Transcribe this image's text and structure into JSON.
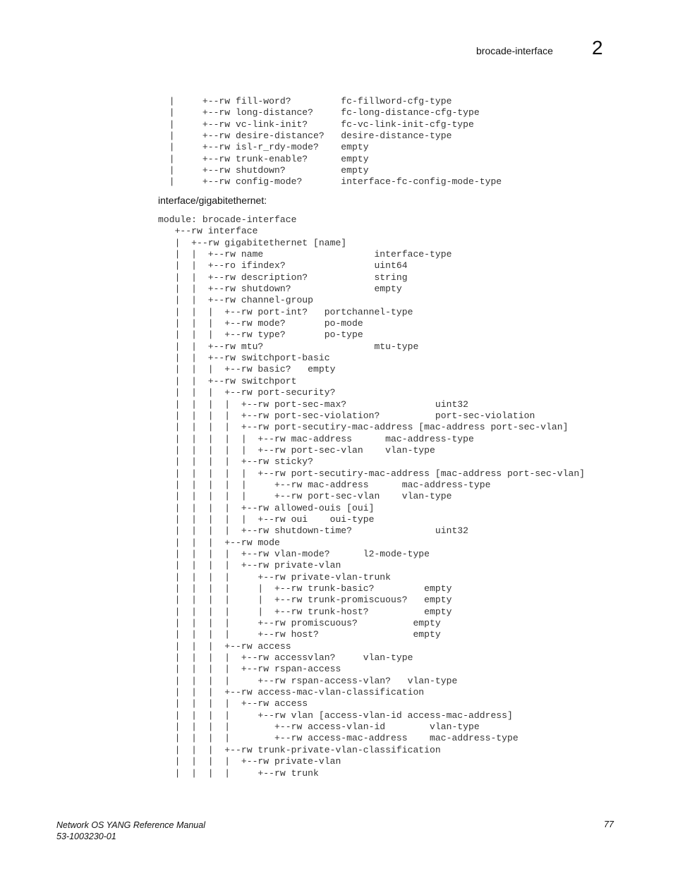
{
  "header": {
    "section_title": "brocade-interface",
    "chapter_number": "2"
  },
  "code_block_1": {
    "lines": [
      "  |     +--rw fill-word?         fc-fillword-cfg-type",
      "  |     +--rw long-distance?     fc-long-distance-cfg-type",
      "  |     +--rw vc-link-init?      fc-vc-link-init-cfg-type",
      "  |     +--rw desire-distance?   desire-distance-type",
      "  |     +--rw isl-r_rdy-mode?    empty",
      "  |     +--rw trunk-enable?      empty",
      "  |     +--rw shutdown?          empty",
      "  |     +--rw config-mode?       interface-fc-config-mode-type"
    ]
  },
  "section_heading": "interface/gigabitethernet:",
  "code_block_2": {
    "lines": [
      "module: brocade-interface",
      "   +--rw interface",
      "   |  +--rw gigabitethernet [name]",
      "   |  |  +--rw name                    interface-type",
      "   |  |  +--ro ifindex?                uint64",
      "   |  |  +--rw description?            string",
      "   |  |  +--rw shutdown?               empty",
      "   |  |  +--rw channel-group",
      "   |  |  |  +--rw port-int?   portchannel-type",
      "   |  |  |  +--rw mode?       po-mode",
      "   |  |  |  +--rw type?       po-type",
      "   |  |  +--rw mtu?                    mtu-type",
      "   |  |  +--rw switchport-basic",
      "   |  |  |  +--rw basic?   empty",
      "   |  |  +--rw switchport",
      "   |  |  |  +--rw port-security?",
      "   |  |  |  |  +--rw port-sec-max?                uint32",
      "   |  |  |  |  +--rw port-sec-violation?          port-sec-violation",
      "   |  |  |  |  +--rw port-secutiry-mac-address [mac-address port-sec-vlan]",
      "   |  |  |  |  |  +--rw mac-address      mac-address-type",
      "   |  |  |  |  |  +--rw port-sec-vlan    vlan-type",
      "   |  |  |  |  +--rw sticky?",
      "   |  |  |  |  |  +--rw port-secutiry-mac-address [mac-address port-sec-vlan]",
      "   |  |  |  |  |     +--rw mac-address      mac-address-type",
      "   |  |  |  |  |     +--rw port-sec-vlan    vlan-type",
      "   |  |  |  |  +--rw allowed-ouis [oui]",
      "   |  |  |  |  |  +--rw oui    oui-type",
      "   |  |  |  |  +--rw shutdown-time?               uint32",
      "   |  |  |  +--rw mode",
      "   |  |  |  |  +--rw vlan-mode?      l2-mode-type",
      "   |  |  |  |  +--rw private-vlan",
      "   |  |  |  |     +--rw private-vlan-trunk",
      "   |  |  |  |     |  +--rw trunk-basic?         empty",
      "   |  |  |  |     |  +--rw trunk-promiscuous?   empty",
      "   |  |  |  |     |  +--rw trunk-host?          empty",
      "   |  |  |  |     +--rw promiscuous?          empty",
      "   |  |  |  |     +--rw host?                 empty",
      "   |  |  |  +--rw access",
      "   |  |  |  |  +--rw accessvlan?     vlan-type",
      "   |  |  |  |  +--rw rspan-access",
      "   |  |  |  |     +--rw rspan-access-vlan?   vlan-type",
      "   |  |  |  +--rw access-mac-vlan-classification",
      "   |  |  |  |  +--rw access",
      "   |  |  |  |     +--rw vlan [access-vlan-id access-mac-address]",
      "   |  |  |  |        +--rw access-vlan-id        vlan-type",
      "   |  |  |  |        +--rw access-mac-address    mac-address-type",
      "   |  |  |  +--rw trunk-private-vlan-classification",
      "   |  |  |  |  +--rw private-vlan",
      "   |  |  |  |     +--rw trunk"
    ]
  },
  "footer": {
    "manual_title": "Network OS YANG Reference Manual",
    "document_number": "53-1003230-01",
    "page_number": "77"
  }
}
